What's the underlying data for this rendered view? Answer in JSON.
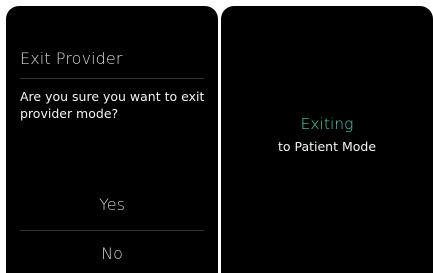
{
  "exit_dialog": {
    "title": "Exit Provider",
    "message": "Are you sure you want to exit provider mode?",
    "yes_label": "Yes",
    "no_label": "No"
  },
  "exiting_screen": {
    "status": "Exiting",
    "detail": "to Patient Mode"
  },
  "colors": {
    "screen_background": "#000000",
    "accent": "#4fcfb4",
    "text_primary": "#f2f2f2",
    "text_secondary": "#cfcfcf"
  }
}
